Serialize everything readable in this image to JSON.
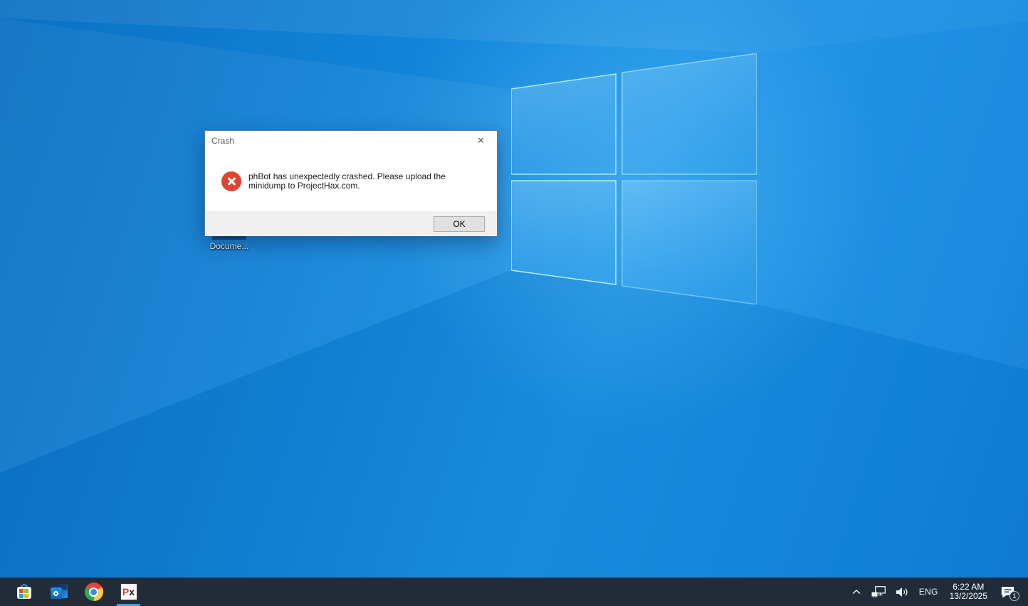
{
  "dialog": {
    "title": "Crash",
    "close_glyph": "✕",
    "message": "phBot has unexpectedly crashed. Please upload the minidump to ProjectHax.com.",
    "ok_label": "OK",
    "error_icon": "error-circle-x-icon",
    "error_color": "#de4433"
  },
  "desktop": {
    "icon_label": "Docume...",
    "wallpaper_logo": "windows-logo"
  },
  "taskbar": {
    "background": "#222c39",
    "active_indicator_color": "#3f9fe0",
    "apps": [
      {
        "icon": "microsoft-store-icon"
      },
      {
        "icon": "outlook-icon"
      },
      {
        "icon": "chrome-icon"
      },
      {
        "icon": "phbot-icon",
        "label_p": "P",
        "label_x": "x",
        "active": true
      }
    ],
    "tray": {
      "chevron_icon": "chevron-up-icon",
      "network_icon": "network-ethernet-icon",
      "volume_icon": "volume-icon",
      "language": "ENG",
      "time": "6:22 AM",
      "date": "13/2/2025",
      "notification_icon": "action-center-icon",
      "badge_count": "1"
    }
  }
}
